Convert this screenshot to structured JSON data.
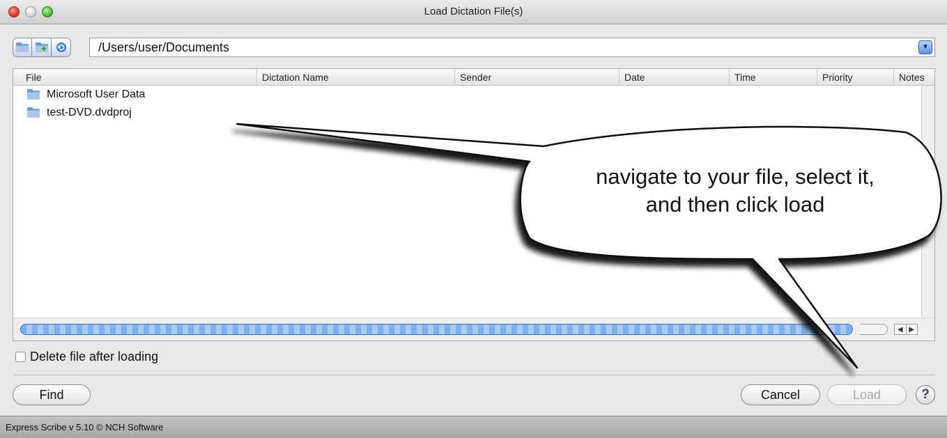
{
  "window": {
    "title": "Load Dictation File(s)"
  },
  "path": {
    "value": "/Users/user/Documents"
  },
  "table": {
    "columns": [
      "File",
      "Dictation Name",
      "Sender",
      "Date",
      "Time",
      "Priority",
      "Notes"
    ],
    "rows": [
      {
        "name": "Microsoft User Data"
      },
      {
        "name": "test-DVD.dvdproj"
      }
    ]
  },
  "options": {
    "delete_after_loading": "Delete file after loading"
  },
  "buttons": {
    "find": "Find",
    "cancel": "Cancel",
    "load": "Load",
    "help": "?"
  },
  "status": {
    "text": "Express Scribe v 5.10 © NCH Software"
  },
  "callout": {
    "line1": "navigate to your file, select it,",
    "line2": "and then click load"
  },
  "colors": {
    "accent_scroll": "#7fb0ee",
    "help_icon": "#5b2d90"
  }
}
